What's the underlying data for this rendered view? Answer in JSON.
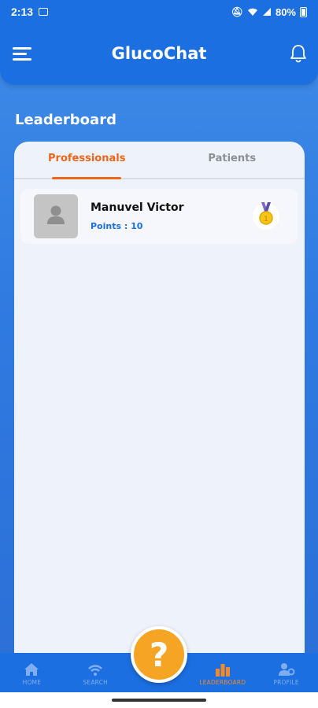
{
  "status_bar": {
    "time": "2:13",
    "battery": "80%"
  },
  "app": {
    "title": "GlucoChat"
  },
  "section": {
    "title": "Leaderboard"
  },
  "tabs": [
    {
      "label": "Professionals",
      "active": true
    },
    {
      "label": "Patients",
      "active": false
    }
  ],
  "leaderboard": [
    {
      "name": "Manuvel Victor",
      "points": "Points : 10",
      "rank_icon": "gold-medal-icon"
    }
  ],
  "bottom_nav": [
    {
      "label": "HOME",
      "icon": "home-icon"
    },
    {
      "label": "SEARCH",
      "icon": "search-icon"
    },
    {
      "label": "LEADERBOARD",
      "icon": "leaderboard-icon",
      "active": true
    },
    {
      "label": "PROFILE",
      "icon": "profile-icon"
    }
  ],
  "fab": {
    "label": "?"
  },
  "colors": {
    "primary": "#1c6fe0",
    "accent": "#f0651a",
    "fab": "#f6a423"
  }
}
